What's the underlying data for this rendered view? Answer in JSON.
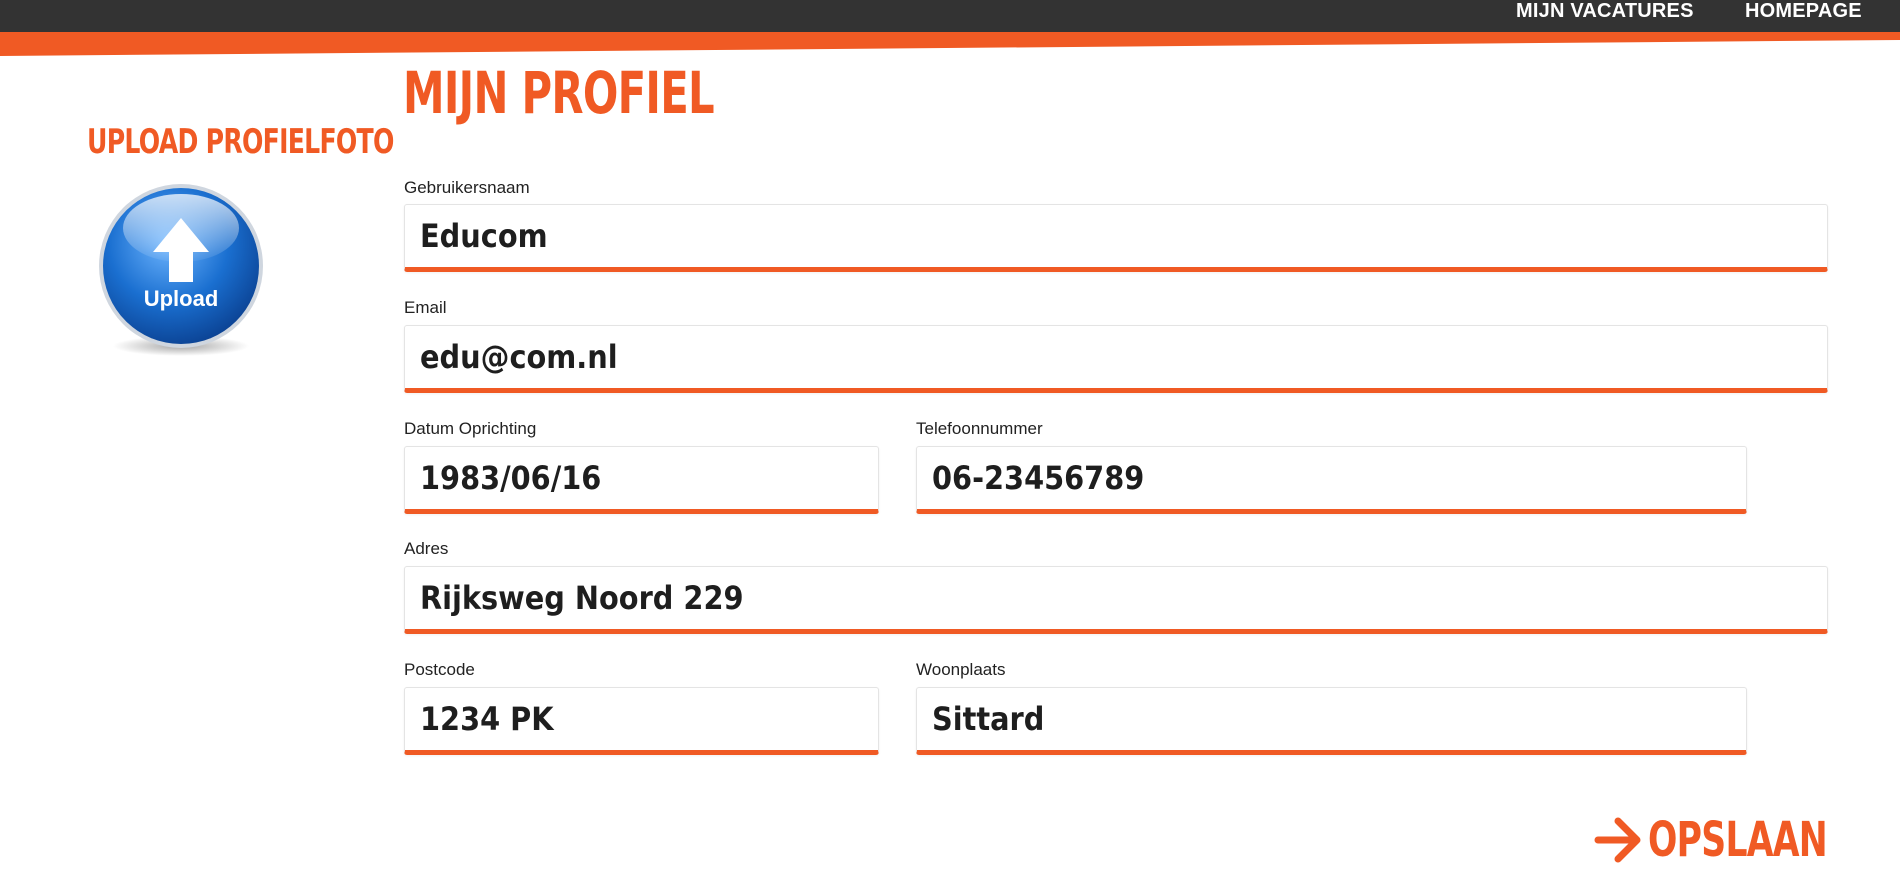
{
  "nav": {
    "items": [
      {
        "label": "MIJN VACATURES"
      },
      {
        "label": "HOMEPAGE"
      }
    ]
  },
  "sidebar": {
    "title": "UPLOAD PROFIELFOTO",
    "upload_icon": "upload-icon",
    "upload_label": "Upload"
  },
  "page": {
    "title": "MIJN PROFIEL"
  },
  "form": {
    "username": {
      "label": "Gebruikersnaam",
      "value": "Educom"
    },
    "email": {
      "label": "Email",
      "value": "edu@com.nl"
    },
    "founding_date": {
      "label": "Datum Oprichting",
      "value": "1983/06/16"
    },
    "phone": {
      "label": "Telefoonnummer",
      "value": "06-23456789"
    },
    "address": {
      "label": "Adres",
      "value": "Rijksweg Noord 229"
    },
    "postcode": {
      "label": "Postcode",
      "value": "1234 PK"
    },
    "city": {
      "label": "Woonplaats",
      "value": "Sittard"
    }
  },
  "actions": {
    "save_label": "OPSLAAN",
    "save_icon": "arrow-right-icon"
  },
  "colors": {
    "accent": "#f05a24",
    "topbar": "#333333",
    "upload_blue": "#1a6fd0"
  }
}
